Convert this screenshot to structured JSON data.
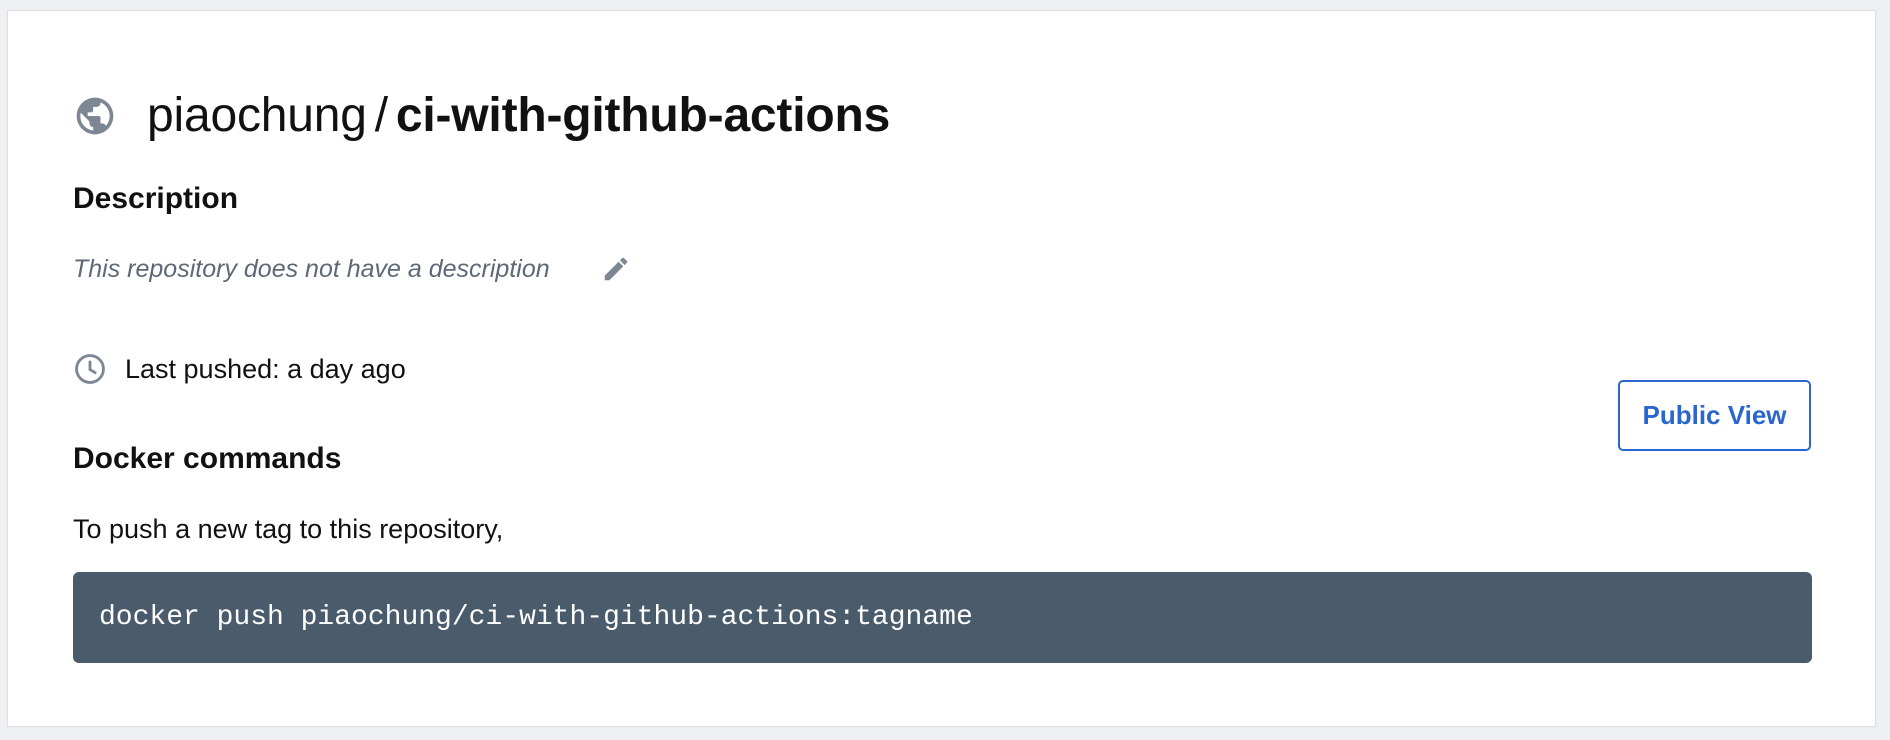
{
  "repository": {
    "owner": "piaochung",
    "separator": "/",
    "name": "ci-with-github-actions",
    "visibility_icon": "globe-icon"
  },
  "description": {
    "heading": "Description",
    "text": "This repository does not have a description",
    "edit_icon": "pencil-icon"
  },
  "last_pushed": {
    "icon": "clock-icon",
    "text": "Last pushed: a day ago"
  },
  "actions": {
    "public_view_label": "Public View"
  },
  "docker_commands": {
    "heading": "Docker commands",
    "instructions": "To push a new tag to this repository,",
    "command": "docker push piaochung/ci-with-github-actions:tagname"
  },
  "colors": {
    "accent": "#2b65d0",
    "command_background": "#4a5b6b",
    "icon_gray": "#7d8794",
    "muted_text": "#5f6875"
  }
}
